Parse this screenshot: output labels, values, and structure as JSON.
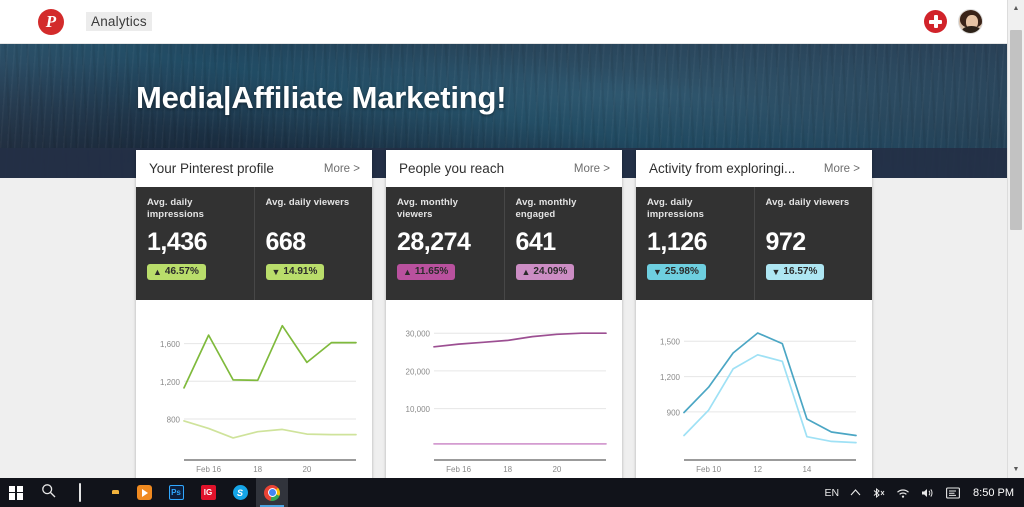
{
  "topnav": {
    "logo_icon": "pinterest-logo-icon",
    "logo_letter": "P",
    "label": "Analytics",
    "add_icon": "plus-icon",
    "avatar_icon": "user-avatar"
  },
  "hero": {
    "title": "Media|Affiliate Marketing!"
  },
  "cards": [
    {
      "title": "Your Pinterest profile",
      "more_label": "More >",
      "metrics": [
        {
          "label": "Avg. daily impressions",
          "value": "1,436",
          "change": "46.57%",
          "direction": "up",
          "arrow": "▲",
          "badge_color": "#b9dd6b"
        },
        {
          "label": "Avg. daily viewers",
          "value": "668",
          "change": "14.91%",
          "direction": "down",
          "arrow": "▼",
          "badge_color": "#b9dd6b"
        }
      ],
      "chart_ref": 0
    },
    {
      "title": "People you reach",
      "more_label": "More >",
      "metrics": [
        {
          "label": "Avg. monthly viewers",
          "value": "28,274",
          "change": "11.65%",
          "direction": "up",
          "arrow": "▲",
          "badge_color": "#b9519e"
        },
        {
          "label": "Avg. monthly engaged",
          "value": "641",
          "change": "24.09%",
          "direction": "up",
          "arrow": "▲",
          "badge_color": "#cc8dc4"
        }
      ],
      "chart_ref": 1
    },
    {
      "title": "Activity from exploringi...",
      "more_label": "More >",
      "metrics": [
        {
          "label": "Avg. daily impressions",
          "value": "1,126",
          "change": "25.98%",
          "direction": "down",
          "arrow": "▼",
          "badge_color": "#6ecfe0"
        },
        {
          "label": "Avg. daily viewers",
          "value": "972",
          "change": "16.57%",
          "direction": "down",
          "arrow": "▼",
          "badge_color": "#aee6f2"
        }
      ],
      "chart_ref": 2
    }
  ],
  "chart_data": [
    {
      "type": "line",
      "title": "Your Pinterest profile",
      "xlabel": "",
      "ylabel": "",
      "x": [
        1,
        2,
        3,
        4,
        5,
        6,
        7,
        8
      ],
      "tick_labels": [
        "",
        "Feb 16",
        "",
        "18",
        "",
        "20",
        "",
        ""
      ],
      "ytick_labels": [
        "1,600",
        "1,200",
        "800"
      ],
      "ytick_values": [
        1600,
        1200,
        800
      ],
      "ylim": [
        450,
        1850
      ],
      "grid": true,
      "series": [
        {
          "name": "Avg. daily impressions",
          "color": "#7fba3c",
          "values": [
            1130,
            1690,
            1215,
            1210,
            1790,
            1400,
            1610,
            1610
          ]
        },
        {
          "name": "Avg. daily viewers",
          "color": "#cfe39b",
          "values": [
            780,
            700,
            600,
            665,
            690,
            640,
            635,
            635
          ]
        }
      ]
    },
    {
      "type": "line",
      "title": "People you reach",
      "xlabel": "",
      "ylabel": "",
      "x": [
        1,
        2,
        3,
        4,
        5,
        6,
        7,
        8
      ],
      "tick_labels": [
        "",
        "Feb 16",
        "",
        "18",
        "",
        "20",
        "",
        ""
      ],
      "ytick_labels": [
        "30,000",
        "20,000",
        "10,000"
      ],
      "ytick_values": [
        30000,
        20000,
        10000
      ],
      "ylim": [
        -1500,
        33500
      ],
      "grid": true,
      "series": [
        {
          "name": "Avg. monthly viewers",
          "color": "#9c4f92",
          "values": [
            26400,
            27100,
            27600,
            28100,
            29100,
            29700,
            30000,
            30000
          ]
        },
        {
          "name": "Avg. monthly engaged",
          "color": "#d49cd0",
          "values": [
            640,
            640,
            640,
            640,
            640,
            645,
            650,
            650
          ]
        }
      ]
    },
    {
      "type": "line",
      "title": "Activity from exploringi...",
      "xlabel": "",
      "ylabel": "",
      "x": [
        1,
        2,
        3,
        4,
        5,
        6,
        7,
        8
      ],
      "tick_labels": [
        "",
        "Feb 10",
        "",
        "12",
        "",
        "14",
        "",
        ""
      ],
      "ytick_labels": [
        "1,500",
        "1,200",
        "900"
      ],
      "ytick_values": [
        1500,
        1200,
        900
      ],
      "ylim": [
        560,
        1680
      ],
      "grid": true,
      "series": [
        {
          "name": "Avg. daily impressions",
          "color": "#4ba6c4",
          "values": [
            895,
            1110,
            1400,
            1570,
            1480,
            840,
            730,
            700
          ]
        },
        {
          "name": "Avg. daily viewers",
          "color": "#9fe1f5",
          "values": [
            700,
            915,
            1265,
            1385,
            1330,
            690,
            650,
            640
          ]
        }
      ]
    }
  ],
  "taskbar": {
    "items": [
      {
        "name": "start-button",
        "icon": "windows-logo-icon",
        "active": false
      },
      {
        "name": "search-button",
        "icon": "search-icon",
        "active": false
      },
      {
        "name": "task-view-button",
        "icon": "task-view-icon",
        "active": false
      },
      {
        "name": "file-explorer-button",
        "icon": "folder-icon",
        "active": false
      },
      {
        "name": "media-player-button",
        "icon": "media-play-icon",
        "active": false
      },
      {
        "name": "photoshop-button",
        "icon": "photoshop-icon",
        "label": "Ps",
        "active": false
      },
      {
        "name": "ig-button",
        "icon": "ig-icon",
        "label": "IG",
        "active": false
      },
      {
        "name": "skype-button",
        "icon": "skype-icon",
        "label": "S",
        "active": false
      },
      {
        "name": "chrome-button",
        "icon": "chrome-icon",
        "active": true
      }
    ],
    "tray": {
      "language": "EN",
      "chevron": "︿",
      "clock": "8:50 PM"
    }
  },
  "scrollbar": {
    "up_arrow": "▲",
    "down_arrow": "▼"
  }
}
